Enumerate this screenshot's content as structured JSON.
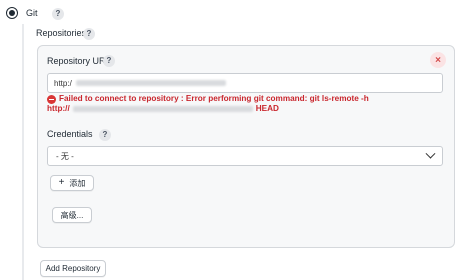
{
  "scm": {
    "label": "Git",
    "selected": true
  },
  "repositories": {
    "label": "Repositories"
  },
  "repo_card": {
    "url_label": "Repository URL",
    "url_value_prefix": "http:/",
    "close_symbol": "×",
    "error": {
      "line1": "Failed to connect to repository : Error performing git command: git ls-remote -h",
      "line2_prefix": "http://",
      "line2_suffix": "HEAD"
    },
    "credentials_label": "Credentials",
    "credentials_value": "- 无 -",
    "add_button": "添加",
    "advanced_button": "高级..."
  },
  "add_repository_button": "Add Repository",
  "help_symbol": "?",
  "plus_symbol": "+",
  "colors": {
    "error": "#c9262d",
    "card_bg": "#f7f8f9",
    "border": "#c9cdd2"
  }
}
